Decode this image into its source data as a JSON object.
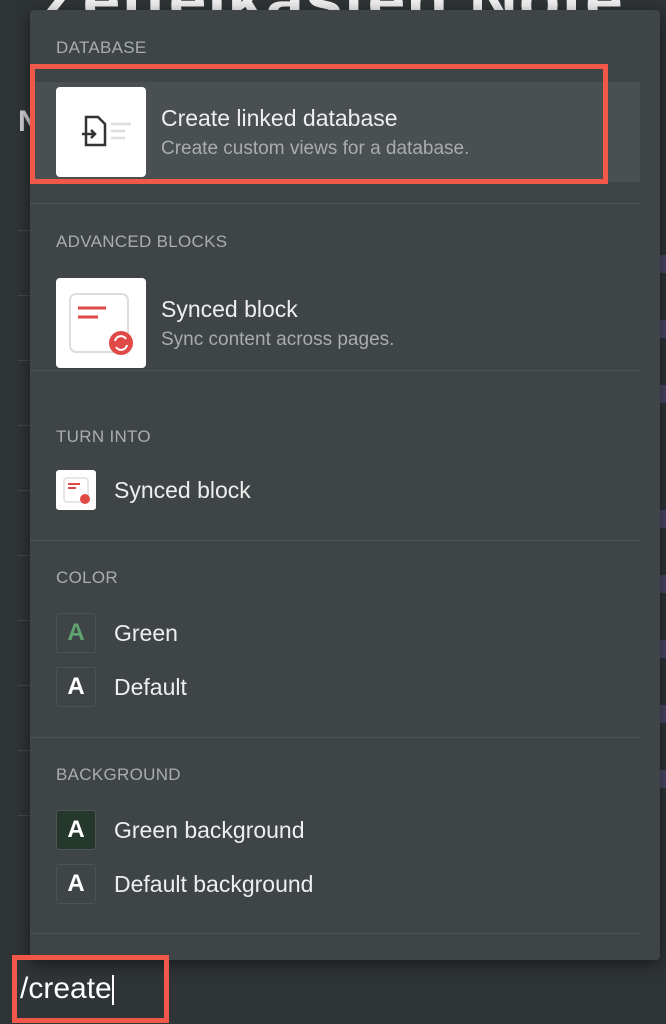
{
  "page": {
    "title": "Zettelkasten Note",
    "side_letter": "N"
  },
  "menu": {
    "sections": [
      {
        "header": "DATABASE",
        "items": [
          {
            "title": "Create linked database",
            "desc": "Create custom views for a database.",
            "icon": "linked-database-icon"
          }
        ]
      },
      {
        "header": "ADVANCED BLOCKS",
        "items": [
          {
            "title": "Synced block",
            "desc": "Sync content across pages.",
            "icon": "synced-block-icon"
          }
        ]
      },
      {
        "header": "TURN INTO",
        "items": [
          {
            "title": "Synced block",
            "icon": "synced-block-icon"
          }
        ]
      },
      {
        "header": "COLOR",
        "items": [
          {
            "title": "Green",
            "glyph": "A",
            "color": "#5fa370"
          },
          {
            "title": "Default",
            "glyph": "A",
            "color": "#ffffff"
          }
        ]
      },
      {
        "header": "BACKGROUND",
        "items": [
          {
            "title": "Green background",
            "glyph": "A",
            "bg": "#24392c"
          },
          {
            "title": "Default background",
            "glyph": "A"
          }
        ]
      }
    ]
  },
  "input": {
    "value": "/create"
  },
  "colors": {
    "highlight": "#f2584a",
    "menu_bg": "#3f4447",
    "page_bg": "#2f3437"
  }
}
